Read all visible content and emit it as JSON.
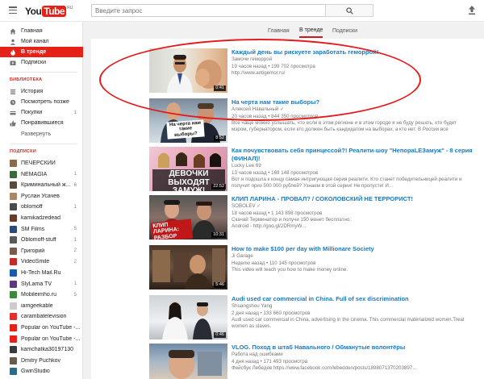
{
  "app": {
    "logo_you": "You",
    "logo_tube": "Tube",
    "logo_region": "RU"
  },
  "search": {
    "placeholder": "Введите запрос",
    "icon": "search-icon"
  },
  "header": {
    "upload_icon": "upload-icon",
    "menu_icon": "hamburger-icon"
  },
  "tabs": [
    {
      "label": "Главная",
      "active": false
    },
    {
      "label": "В тренде",
      "active": true
    },
    {
      "label": "Подписки",
      "active": false
    }
  ],
  "sidebar": {
    "main": [
      {
        "label": "Главная",
        "icon": "home-icon"
      },
      {
        "label": "Мой канал",
        "icon": "person-icon"
      },
      {
        "label": "В тренде",
        "icon": "flame-icon",
        "active": true
      },
      {
        "label": "Подписки",
        "icon": "subscriptions-icon"
      }
    ],
    "library_title": "БИБЛИОТЕКА",
    "library": [
      {
        "label": "История",
        "icon": "history-icon"
      },
      {
        "label": "Посмотреть позже",
        "icon": "clock-icon"
      },
      {
        "label": "Покупки",
        "icon": "purchase-icon",
        "count": "1"
      },
      {
        "label": "Понравившиеся",
        "icon": "thumbs-up-icon"
      }
    ],
    "expand_label": "Развернуть",
    "subs_title": "ПОДПИСКИ",
    "subscriptions": [
      {
        "label": "ПЕЧЁРСКИЙ",
        "count": "",
        "color": "#8a6a4a"
      },
      {
        "label": "NEMAGIA",
        "count": "1",
        "color": "#3a6b3a"
      },
      {
        "label": "Криминальный ж...",
        "count": "6",
        "color": "#5a4a3a"
      },
      {
        "label": "Руслан Усачев",
        "count": "",
        "color": "#aa8866"
      },
      {
        "label": "oblomoff",
        "count": "1",
        "color": "#4a4a4a"
      },
      {
        "label": "kamikadzedead",
        "count": "",
        "color": "#6a3a2a"
      },
      {
        "label": "SM Films",
        "count": "5",
        "color": "#2a4a7a"
      },
      {
        "label": "Oblomoff-stuff",
        "count": "1",
        "color": "#5a5a5a"
      },
      {
        "label": "Григорий",
        "count": "2",
        "color": "#7a5a4a"
      },
      {
        "label": "VideoSmile",
        "count": "2",
        "color": "#c42a2a"
      },
      {
        "label": "Hi-Tech Mail.Ru",
        "count": "",
        "color": "#1a5ab0"
      },
      {
        "label": "SlyLama TV",
        "count": "1",
        "color": "#5a3a7a"
      },
      {
        "label": "Mobileimho.ru",
        "count": "5",
        "color": "#3a8a3a"
      },
      {
        "label": "iamgeekable",
        "count": "",
        "color": "#cccccc"
      },
      {
        "label": "carambatelevision",
        "count": "",
        "color": "#e03030"
      },
      {
        "label": "Popular on YouTube -...",
        "count": "",
        "color": "#e62117"
      },
      {
        "label": "Popular on YouTube -...",
        "count": "",
        "color": "#e62117"
      },
      {
        "label": "kamchatka30197130",
        "count": "",
        "color": "#3a3a3a"
      },
      {
        "label": "Dmitry Puchkov",
        "count": "",
        "color": "#6a5a4a"
      },
      {
        "label": "GwinStudio",
        "count": "",
        "color": "#2a6a8a"
      }
    ]
  },
  "videos": [
    {
      "title": "Каждый день вы рискуете заработать геморрой!",
      "channel": "Замочи геморрой",
      "meta": "19 часов назад • 199 702 просмотра",
      "desc": [
        "http://www.antigemor.ru/"
      ],
      "duration": "0:41",
      "overlay": ""
    },
    {
      "title": "На черта нам такие выборы?",
      "channel": "Алексей Навальный ✓",
      "meta": "20 часов назад • 844 350 просмотров",
      "desc": [
        "Все чаще можно услышать, что если в этом регионе и в этом городе я не буду решать, кто будет мэром, губернатором, если кто должен быть кандидатом на выборах, а кто нет. В России все устроено..."
      ],
      "duration": "8:52",
      "overlay": "На черта нам такие выборы?"
    },
    {
      "title": "Как почувствовать себя принцессой?! Реалити-шоу \"НепораLЕЗамуж\" - 8 серия (ФИНАЛ)!",
      "channel": "Lucky Lee 69",
      "meta": "13 часов назад • 169 148 просмотров",
      "desc": [
        "Вот и подошла к концу самая интригующая серия реалити. Кто станет победительницей реалити и получит приз 500 000 рублей? Узнаем в этой серии! Не пропусти! И..."
      ],
      "duration": "22:52",
      "overlay": "ДЕВОЧКИ ВЫХОДЯТ ЗАМУЖ!"
    },
    {
      "title": "КЛИП ЛАРИНА - ПРОВАЛ? / СОКОЛОВСКИЙ НЕ ТЕРРОРИСТ!",
      "channel": "SOBOLEV ✓",
      "meta": "18 часов назад • 1 143 898 просмотров",
      "desc": [
        "Скачай Терминатор и получи 150 монет бесплатно:",
        "Android - http://goo.gl/2DRmyW..."
      ],
      "duration": "10:31",
      "overlay": "КЛИП ЛАРИНА: РАЗБОР"
    },
    {
      "title": "How to make $100 per day with Millionare Society",
      "channel": "Ji Garage",
      "meta": "Неделю назад • 110 145 просмотров",
      "desc": [
        "This video will teach you how to make money online."
      ],
      "duration": "5:46",
      "overlay": ""
    },
    {
      "title": "Audi used car commercial in China. Full of sex discrimination",
      "channel": "Shuangshou Yang",
      "meta": "2 дня назад • 133 660 просмотров",
      "desc": [
        "Audi used car commercial in China, advertising in the cinema. This commercial materialized women.Treat women as slaves."
      ],
      "duration": "0:46",
      "overlay": ""
    },
    {
      "title": "VLOG. Поход в штаб Навального / Обманутые волонтёры",
      "channel": "Работа над ошибками",
      "meta": "4 дня назад • 171 493 просмотра",
      "desc": [
        "Фейсбук Лебедев https://www.facebook.com/lebedden/posts/1898071370203897..."
      ],
      "duration": "",
      "overlay": ""
    }
  ]
}
